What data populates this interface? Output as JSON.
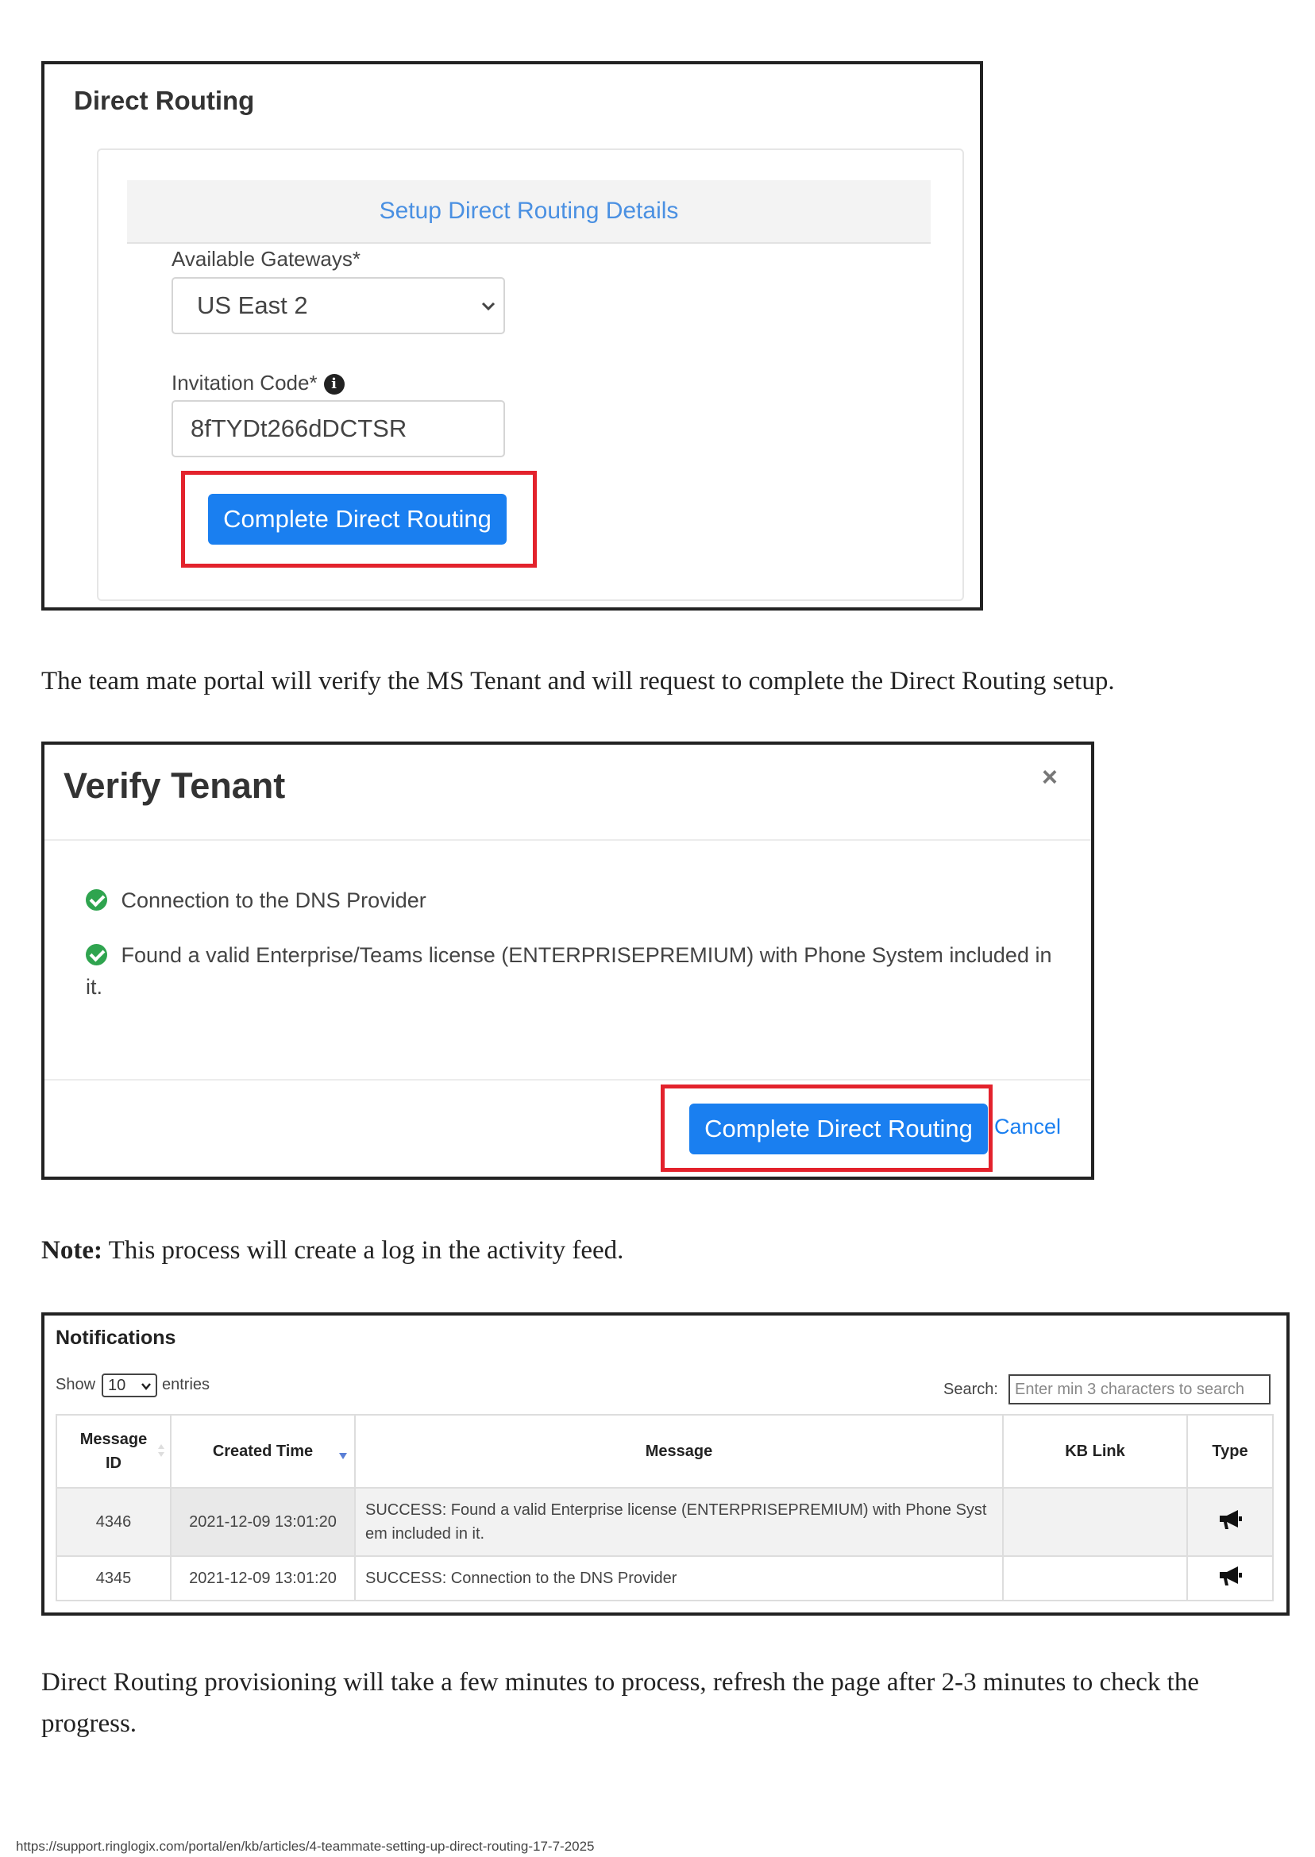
{
  "direct_routing": {
    "title": "Direct Routing",
    "card_header": "Setup Direct Routing Details",
    "gateways_label": "Available Gateways*",
    "gateway_value": "US East 2",
    "invitation_label": "Invitation Code*",
    "invitation_value": "8fTYDt266dDCTSR",
    "complete_button": "Complete Direct Routing"
  },
  "para1": "The team mate portal will verify the MS Tenant and will request to complete the Direct Routing setup.",
  "verify_tenant": {
    "title": "Verify Tenant",
    "close": "×",
    "item1": "Connection to the DNS Provider",
    "item2": "Found a valid Enterprise/Teams license (ENTERPRISEPREMIUM) with Phone System included in it.",
    "complete_button": "Complete Direct Routing",
    "cancel_link": "Cancel"
  },
  "note": {
    "label": "Note:",
    "text": " This process will create a log in the activity feed."
  },
  "notifications": {
    "title": "Notifications",
    "show_label": "Show",
    "show_value": "10",
    "entries_label": "entries",
    "search_label": "Search:",
    "search_placeholder": "Enter min 3 characters to search",
    "headers": [
      "Message ID",
      "Created Time",
      "Message",
      "KB Link",
      "Type"
    ],
    "rows": [
      {
        "id": "4346",
        "time": "2021-12-09 13:01:20",
        "message": "SUCCESS: Found a valid Enterprise license (ENTERPRISEPREMIUM) with Phone System included in it.",
        "kb": ""
      },
      {
        "id": "4345",
        "time": "2021-12-09 13:01:20",
        "message": "SUCCESS: Connection to the DNS Provider",
        "kb": ""
      }
    ],
    "type_icon": "megaphone-icon"
  },
  "para2": "Direct Routing provisioning will take a few minutes to process, refresh the page after 2-3 minutes to check the progress.",
  "footer_url": "https://support.ringlogix.com/portal/en/kb/articles/4-teammate-setting-up-direct-routing-17-7-2025"
}
